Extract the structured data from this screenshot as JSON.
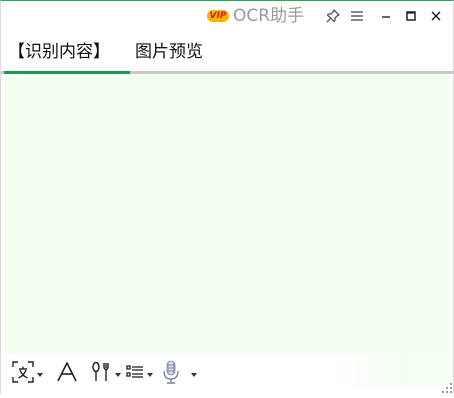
{
  "window": {
    "vip_badge": "VIP",
    "title": "OCR助手"
  },
  "titlebar_icons": [
    "pin-icon",
    "menu-icon",
    "minimize-icon",
    "maximize-icon",
    "close-icon"
  ],
  "tabs": [
    {
      "label": "【识别内容】",
      "active": true
    },
    {
      "label": "图片预览",
      "active": false
    }
  ],
  "content": {
    "value": ""
  },
  "toolbar": {
    "tools": [
      "translate-icon",
      "font-icon",
      "typography-icon",
      "list-format-icon",
      "microphone-icon"
    ]
  },
  "colors": {
    "accent": "#1e9a4a",
    "content_bg": "#f2fff0",
    "title_text": "#9a9a9a",
    "vip_bg": "#f6b400",
    "vip_text": "#d32020"
  }
}
